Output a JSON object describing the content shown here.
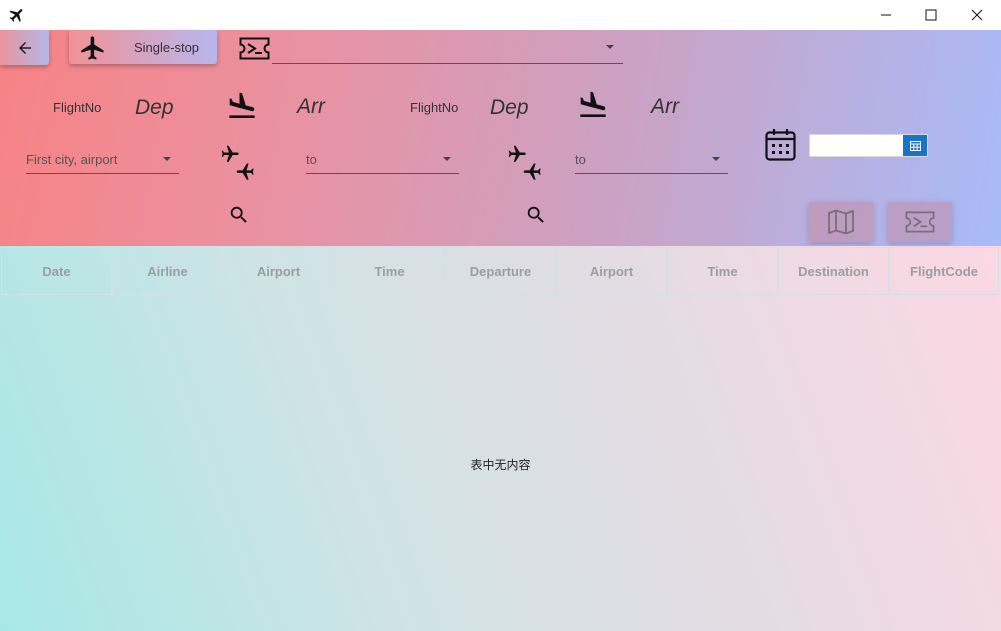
{
  "window": {
    "app_icon": "airplane-icon",
    "controls": [
      "minimize-icon",
      "maximize-icon",
      "close-icon"
    ]
  },
  "toolbar": {
    "back_icon": "arrow-left-icon",
    "mode_label": "Single-stop",
    "mode_icon": "airplane-icon",
    "ticket_icon": "ticket-icon",
    "route_combo_value": ""
  },
  "leg1": {
    "flightno_label": "FlightNo",
    "dep_label": "Dep",
    "arr_label": "Arr",
    "from_placeholder": "First city, airport",
    "to_placeholder": "to"
  },
  "leg2": {
    "flightno_label": "FlightNo",
    "dep_label": "Dep",
    "arr_label": "Arr",
    "to_placeholder": "to"
  },
  "date": {
    "icon": "calendar-icon",
    "value": ""
  },
  "actions": {
    "map_icon": "map-icon",
    "ticket_icon": "ticket-icon"
  },
  "table": {
    "columns": [
      "Date",
      "Airline",
      "Airport",
      "Time",
      "Departure",
      "Airport",
      "Time",
      "Destination",
      "FlightCode"
    ],
    "rows": [],
    "empty_message": "表中无内容"
  },
  "colors": {
    "header_left": "#f78385",
    "header_right": "#a8bbf8",
    "table_left": "#a7e8e5",
    "table_right": "#fcd8e3",
    "date_button": "#1a73c9"
  }
}
